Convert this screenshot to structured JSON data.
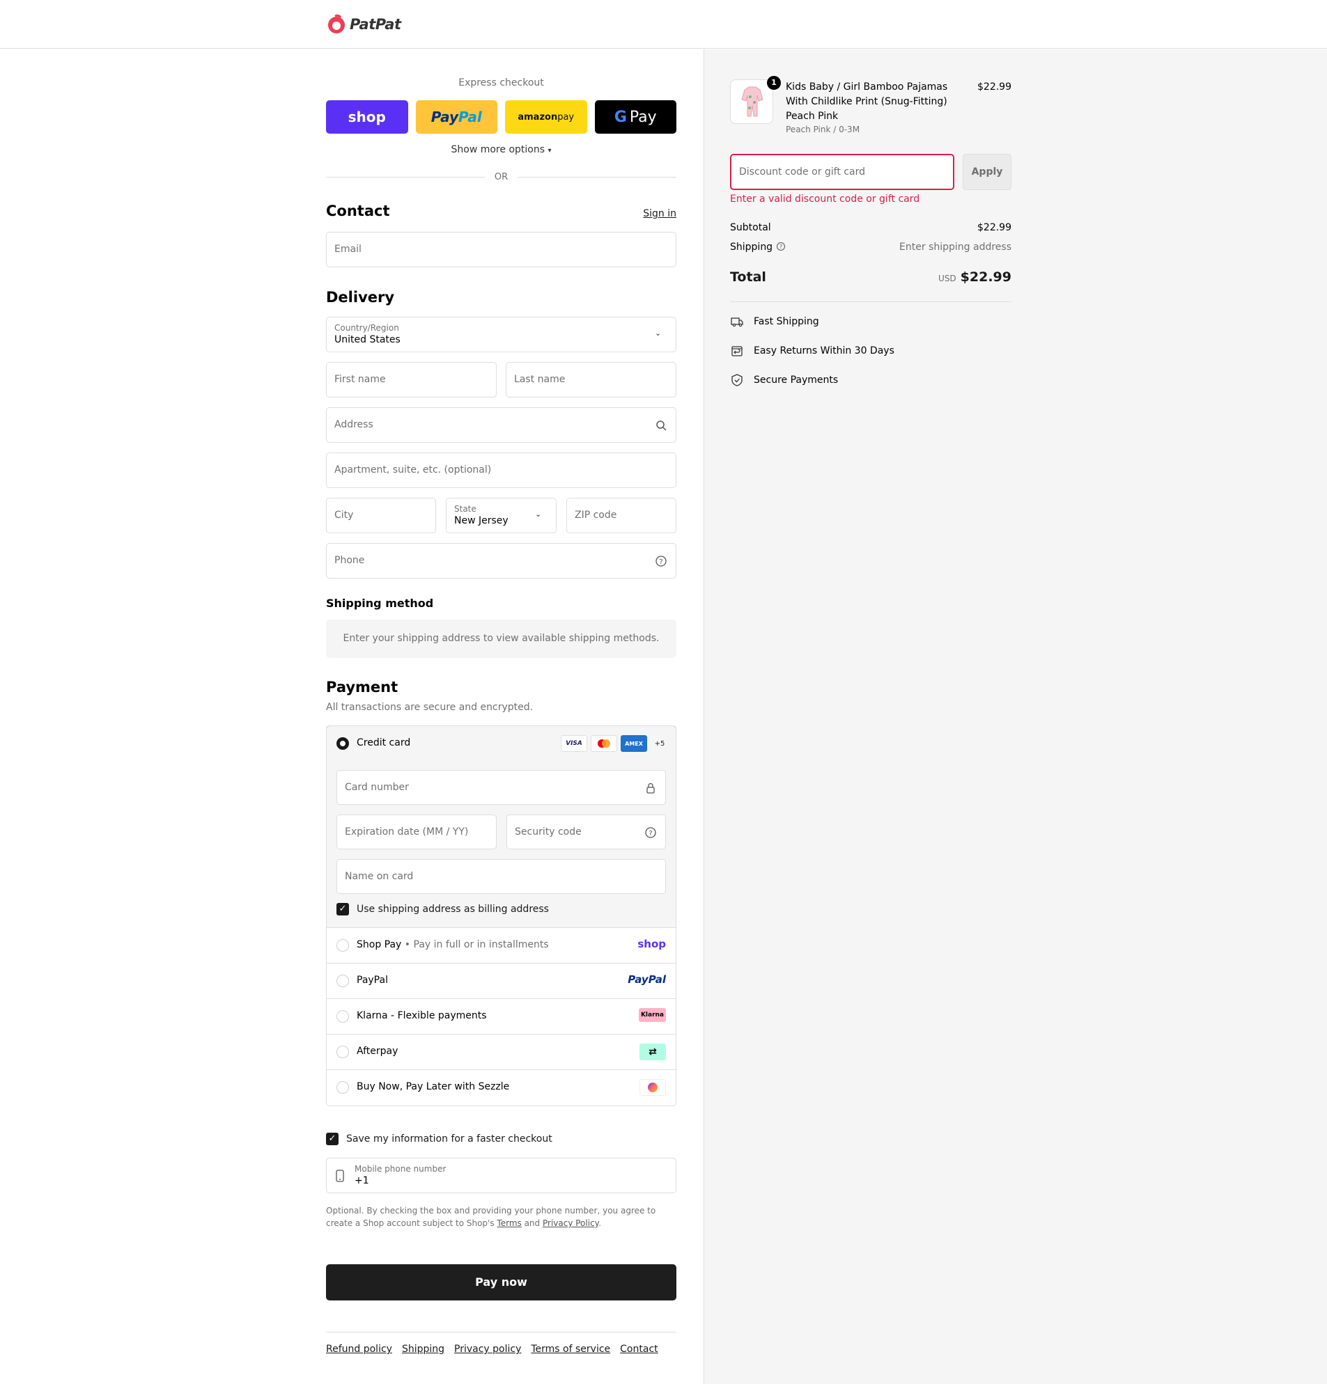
{
  "brand": {
    "name": "PatPat"
  },
  "express": {
    "title": "Express checkout",
    "shop": "shop",
    "paypal_a": "Pay",
    "paypal_b": "Pal",
    "amazon_a": "amazon",
    "amazon_b": " pay",
    "gpay_g": "G",
    "gpay": "Pay",
    "more": "Show more options",
    "or": "OR"
  },
  "contact": {
    "title": "Contact",
    "sign_in": "Sign in",
    "email_ph": "Email"
  },
  "delivery": {
    "title": "Delivery",
    "country_label": "Country/Region",
    "country": "United States",
    "first_ph": "First name",
    "last_ph": "Last name",
    "address_ph": "Address",
    "apt_ph": "Apartment, suite, etc. (optional)",
    "city_ph": "City",
    "state_label": "State",
    "state": "New Jersey",
    "zip_ph": "ZIP code",
    "phone_ph": "Phone"
  },
  "shipping": {
    "title": "Shipping method",
    "note": "Enter your shipping address to view available shipping methods."
  },
  "payment": {
    "title": "Payment",
    "subtitle": "All transactions are secure and encrypted.",
    "credit_card": "Credit card",
    "cards": {
      "visa": "VISA",
      "amex": "AMEX",
      "more": "+5"
    },
    "card_number_ph": "Card number",
    "expiry_ph": "Expiration date (MM / YY)",
    "cvv_ph": "Security code",
    "name_ph": "Name on card",
    "billing_same": "Use shipping address as billing address",
    "methods": [
      {
        "label": "Shop Pay",
        "sub": " • Pay in full or in installments",
        "brand": "shop"
      },
      {
        "label": "PayPal",
        "brand": "PayPal"
      },
      {
        "label": "Klarna - Flexible payments",
        "brand": "Klarna"
      },
      {
        "label": "Afterpay",
        "brand": "⇄"
      },
      {
        "label": "Buy Now, Pay Later with Sezzle",
        "brand": ""
      }
    ]
  },
  "save": {
    "label": "Save my information for a faster checkout",
    "mobile_label": "Mobile phone number",
    "mobile_val": "+1",
    "legal_a": "Optional. By checking the box and providing your phone number, you agree to create a Shop account subject to Shop's ",
    "terms": "Terms",
    "and": " and ",
    "privacy": "Privacy Policy",
    "dot": "."
  },
  "pay_now": "Pay now",
  "footer": [
    "Refund policy",
    "Shipping",
    "Privacy policy",
    "Terms of service",
    "Contact"
  ],
  "order": {
    "qty": "1",
    "product": "Kids Baby / Girl Bamboo Pajamas With Childlike Print (Snug-Fitting) Peach Pink",
    "variant": "Peach Pink / 0-3M",
    "price": "$22.99",
    "discount_ph": "Discount code or gift card",
    "apply": "Apply",
    "discount_error": "Enter a valid discount code or gift card",
    "subtotal_label": "Subtotal",
    "subtotal": "$22.99",
    "shipping_label": "Shipping",
    "shipping_val": "Enter shipping address",
    "total_label": "Total",
    "currency": "USD",
    "total": "$22.99",
    "perks": [
      "Fast Shipping",
      "Easy Returns Within 30 Days",
      "Secure Payments"
    ]
  },
  "colors": {
    "accent": "#1e1e1e",
    "error": "#dd1d4a",
    "shop": "#5a31f4",
    "paypal": "#ffc439",
    "amazon": "#ffd814"
  }
}
